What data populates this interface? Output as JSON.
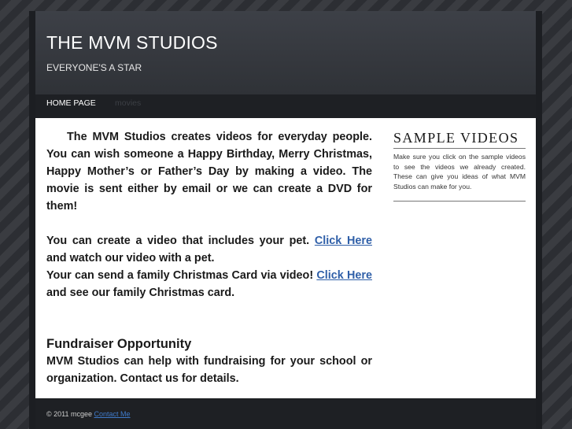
{
  "header": {
    "title": "THE MVM STUDIOS",
    "tagline": "EVERYONE'S A STAR"
  },
  "nav": {
    "items": [
      {
        "label": "HOME PAGE"
      },
      {
        "label": "movies"
      }
    ]
  },
  "main": {
    "intro": "The MVM Studios creates videos for everyday people. You can wish someone a Happy Birthday, Merry Christmas, Happy Mother’s or Father’s Day by making a video. The movie is sent either by email or we can create a DVD for them!",
    "pet_text": "You can create a video that includes your pet.",
    "pet_link": "Click Here",
    "pet_tail": "and watch our video with a pet.",
    "card_text": "Your can send a family Christmas Card via video!",
    "card_link": "Click Here",
    "card_tail": "and see our family Christmas card.",
    "fundraiser_heading": "Fundraiser Opportunity",
    "fundraiser_text": "MVM Studios can help with fundraising for your school or organization. Contact us for details."
  },
  "sidebar": {
    "title": "SAMPLE VIDEOS",
    "text": "Make sure you click on the sample videos to see the videos we already created. These can give you ideas of what MVM Studios can make for you."
  },
  "footer": {
    "copyright": "© 2011 mcgee",
    "contact_link": "Contact Me"
  },
  "colors": {
    "background": "#2a2c31",
    "header": "#3d4047",
    "nav_bar": "#1e2024",
    "link": "#2f5fa8",
    "footer_link": "#3f7ac9"
  }
}
